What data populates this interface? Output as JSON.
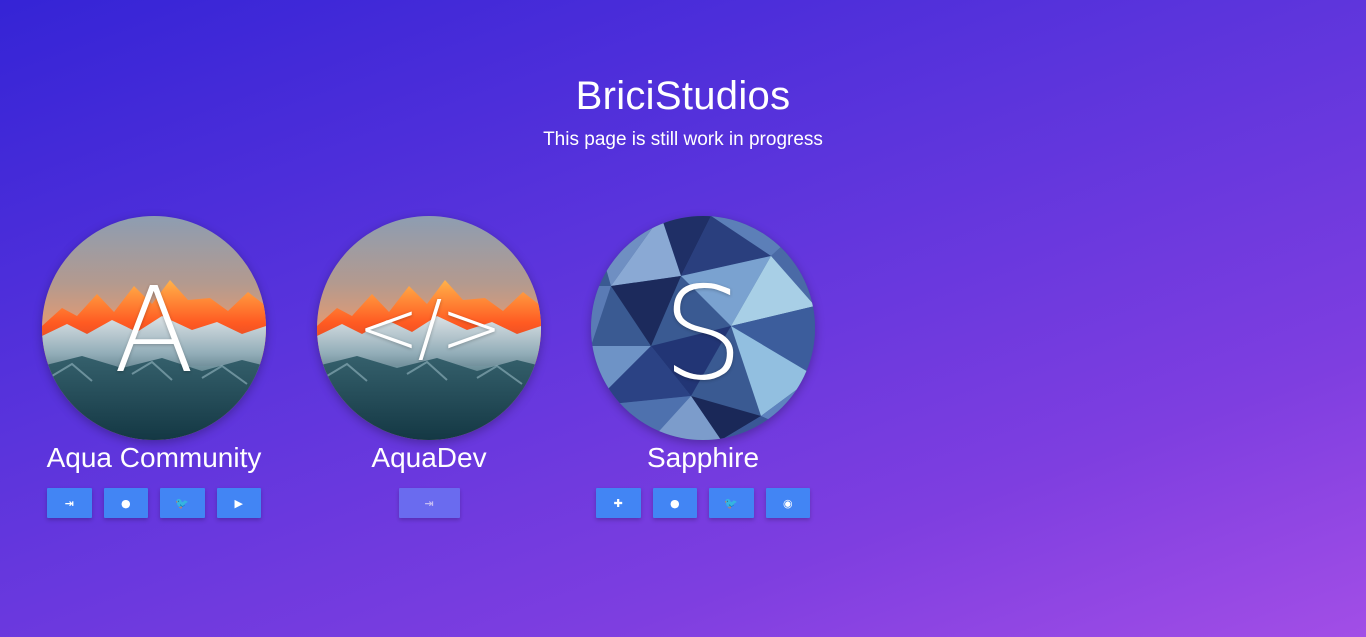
{
  "header": {
    "title": "BriciStudios",
    "subtitle": "This page is still work in progress"
  },
  "cards": [
    {
      "name": "Aqua Community",
      "glyph": "A",
      "image": "mountain-sunset",
      "buttons": [
        {
          "icon": "sign-in-icon",
          "symbol": "⇥"
        },
        {
          "icon": "globe-icon",
          "symbol": "●"
        },
        {
          "icon": "twitter-icon",
          "symbol": "🐦"
        },
        {
          "icon": "youtube-icon",
          "symbol": "▶"
        }
      ]
    },
    {
      "name": "AquaDev",
      "glyph": "</>",
      "image": "mountain-sunset",
      "buttons": [
        {
          "icon": "sign-in-icon",
          "symbol": "⇥",
          "disabled": true
        }
      ]
    },
    {
      "name": "Sapphire",
      "glyph": "S",
      "image": "blue-low-poly",
      "buttons": [
        {
          "icon": "plus-icon",
          "symbol": "✚"
        },
        {
          "icon": "globe-icon",
          "symbol": "●"
        },
        {
          "icon": "twitter-icon",
          "symbol": "🐦"
        },
        {
          "icon": "github-icon",
          "symbol": "◉"
        }
      ]
    }
  ],
  "colors": {
    "button": "#4285f4",
    "button_disabled": "#6a6ef0",
    "text": "#ffffff"
  }
}
